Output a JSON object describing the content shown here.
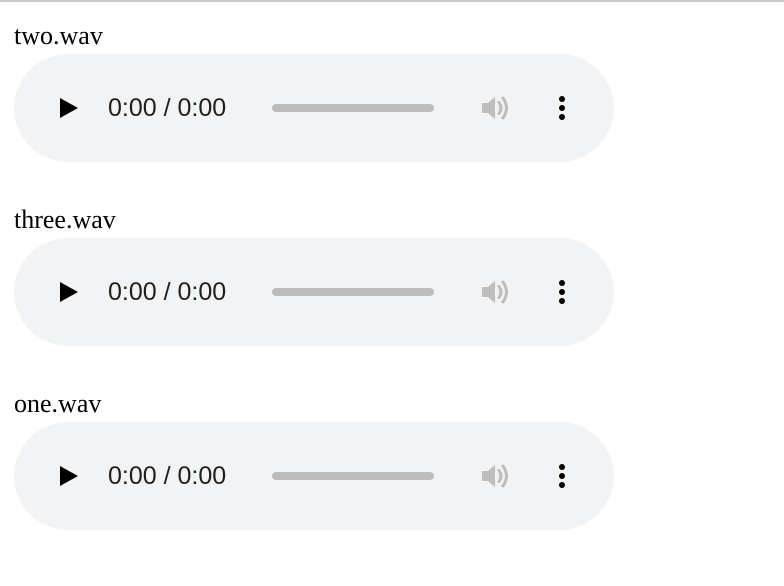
{
  "audio_files": [
    {
      "filename": "two.wav",
      "time_display": "0:00 / 0:00",
      "progress_fraction": 0
    },
    {
      "filename": "three.wav",
      "time_display": "0:00 / 0:00",
      "progress_fraction": 0
    },
    {
      "filename": "one.wav",
      "time_display": "0:00 / 0:00",
      "progress_fraction": 0
    }
  ],
  "icons": {
    "play": "play-icon",
    "volume": "volume-icon",
    "more": "more-options-icon"
  },
  "colors": {
    "player_background": "#f1f3f4",
    "icon": "#1f1f1f",
    "volume_icon_disabled": "#bdbdbd",
    "progress_track": "#bdbdbd"
  }
}
